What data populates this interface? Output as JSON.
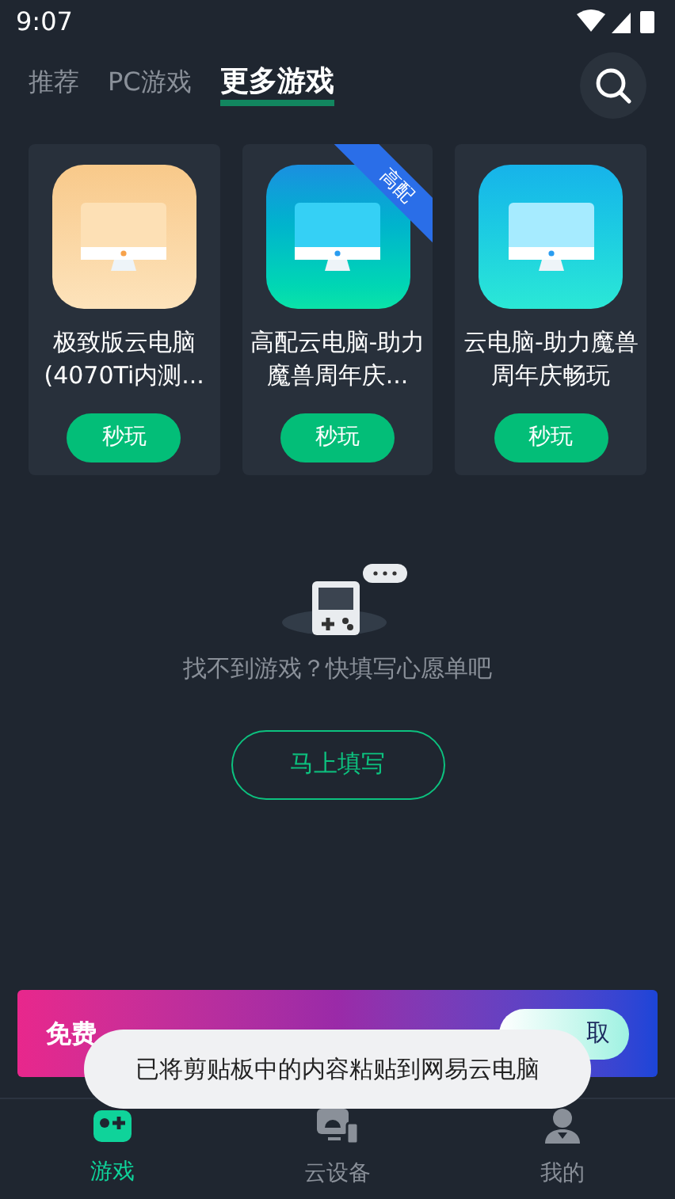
{
  "status_bar": {
    "time": "9:07"
  },
  "tabs": [
    {
      "label": "推荐",
      "selected": false
    },
    {
      "label": "PC游戏",
      "selected": false
    },
    {
      "label": "更多游戏",
      "selected": true
    }
  ],
  "games": [
    {
      "title": "极致版云电脑(4070Ti内测...",
      "kind": "gold",
      "button": "秒玩"
    },
    {
      "title": "高配云电脑-助力魔兽周年庆...",
      "kind": "emerald",
      "ribbon": "高配",
      "button": "秒玩"
    },
    {
      "title": "云电脑-助力魔兽周年庆畅玩",
      "kind": "aqua",
      "button": "秒玩"
    }
  ],
  "empty_state": {
    "message": "找不到游戏？快填写心愿单吧",
    "button": "马上填写"
  },
  "banner": {
    "title": "免费",
    "button": "取"
  },
  "toast": "已将剪贴板中的内容粘贴到网易云电脑",
  "bottom_nav": [
    {
      "label": "游戏",
      "kind": "gamepad",
      "selected": true
    },
    {
      "label": "云设备",
      "kind": "device",
      "selected": false
    },
    {
      "label": "我的",
      "kind": "person",
      "selected": false
    }
  ]
}
